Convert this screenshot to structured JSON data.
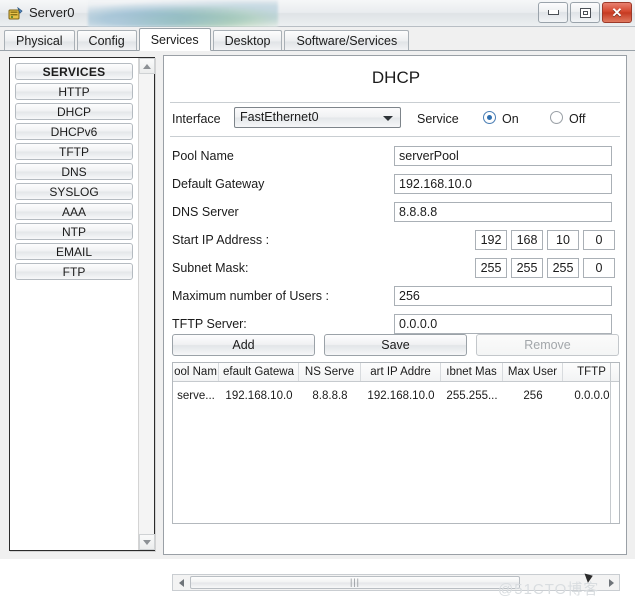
{
  "window": {
    "title": "Server0",
    "icon": "server-icon",
    "controls": {
      "minimize": "minimize-icon",
      "maximize": "maximize-icon",
      "close": "✕"
    }
  },
  "tabs": [
    {
      "label": "Physical",
      "active": false
    },
    {
      "label": "Config",
      "active": false
    },
    {
      "label": "Services",
      "active": true
    },
    {
      "label": "Desktop",
      "active": false
    },
    {
      "label": "Software/Services",
      "active": false
    }
  ],
  "sidebar": {
    "items": [
      {
        "label": "SERVICES",
        "header": true
      },
      {
        "label": "HTTP",
        "header": false
      },
      {
        "label": "DHCP",
        "header": false
      },
      {
        "label": "DHCPv6",
        "header": false
      },
      {
        "label": "TFTP",
        "header": false
      },
      {
        "label": "DNS",
        "header": false
      },
      {
        "label": "SYSLOG",
        "header": false
      },
      {
        "label": "AAA",
        "header": false
      },
      {
        "label": "NTP",
        "header": false
      },
      {
        "label": "EMAIL",
        "header": false
      },
      {
        "label": "FTP",
        "header": false
      }
    ]
  },
  "main": {
    "title": "DHCP",
    "interface": {
      "label": "Interface",
      "value": "FastEthernet0"
    },
    "service": {
      "label": "Service",
      "on_label": "On",
      "off_label": "Off",
      "selected": "On"
    },
    "fields": [
      {
        "label": "Pool Name",
        "value": "serverPool"
      },
      {
        "label": "Default Gateway",
        "value": "192.168.10.0"
      },
      {
        "label": "DNS Server",
        "value": "8.8.8.8"
      }
    ],
    "start_ip": {
      "label": "Start IP Address :",
      "octets": [
        "192",
        "168",
        "10",
        "0"
      ]
    },
    "subnet_mask": {
      "label": "Subnet Mask:",
      "octets": [
        "255",
        "255",
        "255",
        "0"
      ]
    },
    "max_users": {
      "label": "Maximum number of Users :",
      "value": "256"
    },
    "tftp_server": {
      "label": "TFTP Server:",
      "value": "0.0.0.0"
    },
    "buttons": {
      "add": "Add",
      "save": "Save",
      "remove": "Remove"
    },
    "table": {
      "headers": [
        "ool Nam",
        "efault Gatewa",
        "NS Serve",
        "art IP Addre",
        "ıbnet Mas",
        "Max User",
        "TFTP"
      ],
      "rows": [
        [
          "serve...",
          "192.168.10.0",
          "8.8.8.8",
          "192.168.10.0",
          "255.255...",
          "256",
          "0.0.0.0"
        ]
      ]
    },
    "scrollbar": {
      "grip": "|||"
    }
  },
  "watermark": "@51CTO博客"
}
